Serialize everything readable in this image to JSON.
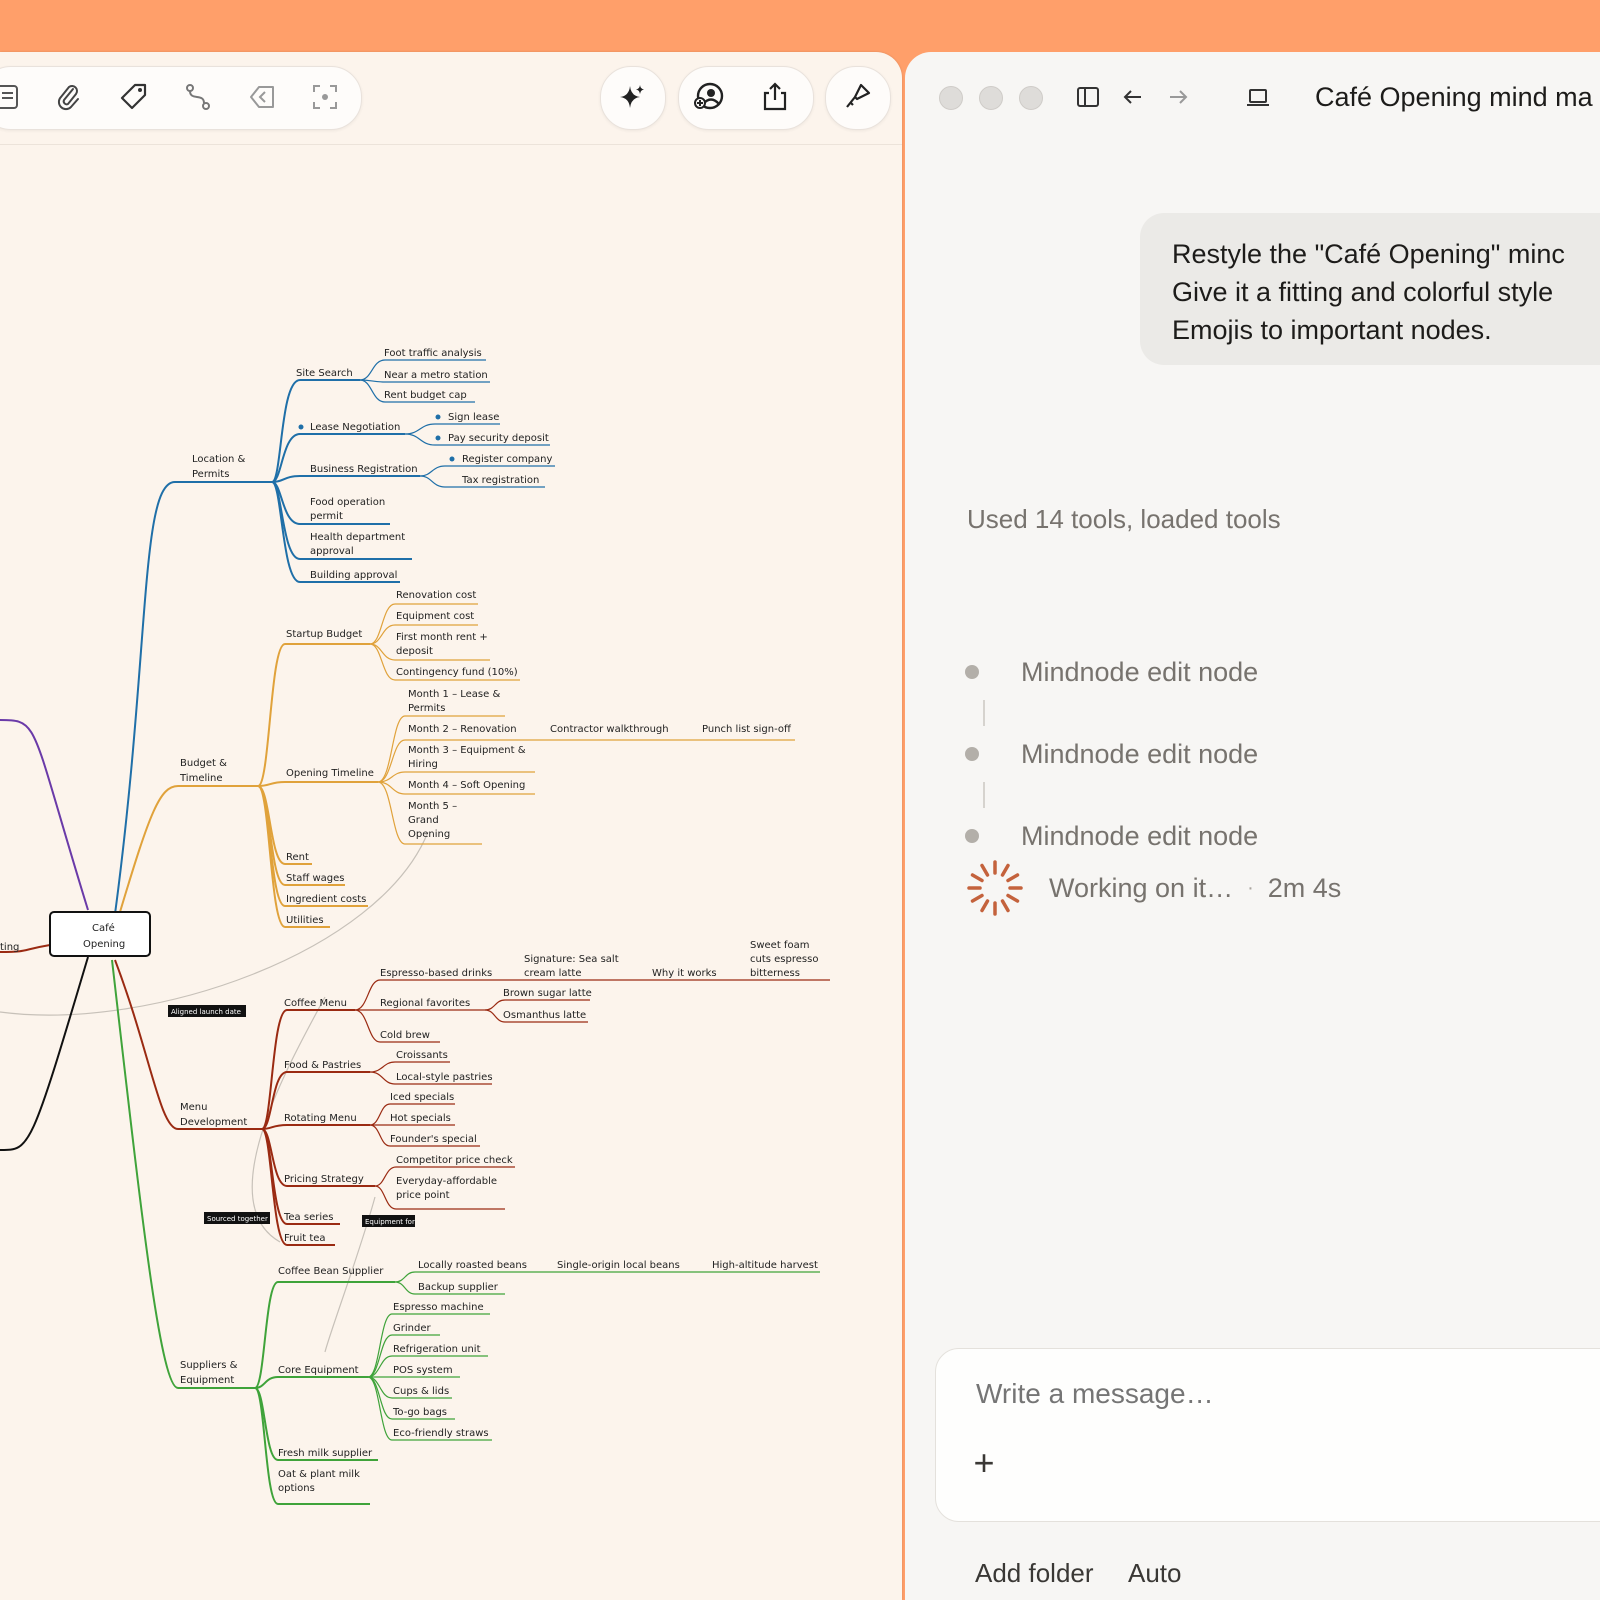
{
  "toolbar": {
    "left_icons": [
      "note-icon",
      "paperclip-icon",
      "tag-icon",
      "connection-icon",
      "back-arrow-icon",
      "focus-icon"
    ],
    "right_icons": [
      "sparkle-icon",
      "collaborate-icon",
      "share-icon",
      "style-brush-icon"
    ]
  },
  "mindmap": {
    "root": "Café Opening",
    "root_line2": "Opening",
    "root_line1": "Café",
    "left_stub": "ting",
    "highlight_labels": [
      "Aligned launch date",
      "Sourced together",
      "Equipment for"
    ],
    "branches": [
      {
        "name": "Location & Permits",
        "color": "#1f6fa8",
        "children": [
          "Site Search",
          "Lease Negotiation",
          "Business Registration",
          "Food operation permit",
          "Health department approval",
          "Building approval"
        ],
        "leaves": [
          "Foot traffic analysis",
          "Near a metro station",
          "Rent budget cap",
          "Sign lease",
          "Pay security deposit",
          "Register company",
          "Tax registration"
        ]
      },
      {
        "name": "Budget & Timeline",
        "color": "#e0a23b",
        "children": [
          "Startup Budget",
          "Opening Timeline",
          "Rent",
          "Staff wages",
          "Ingredient costs",
          "Utilities"
        ],
        "leaves": [
          "Renovation cost",
          "Equipment cost",
          "First month rent + deposit",
          "Contingency fund (10%)",
          "Month 1 – Lease & Permits",
          "Month 2 – Renovation",
          "Contractor walkthrough",
          "Punch list sign-off",
          "Month 3 – Equipment & Hiring",
          "Month 4 – Soft Opening",
          "Month 5 – Grand Opening"
        ]
      },
      {
        "name": "Menu Development",
        "color": "#9a2a12",
        "children": [
          "Coffee Menu",
          "Food & Pastries",
          "Rotating Menu",
          "Pricing Strategy",
          "Tea series",
          "Fruit tea"
        ],
        "leaves": [
          "Espresso-based drinks",
          "Signature: Sea salt cream latte",
          "Why it works",
          "Sweet foam cuts espresso bitterness",
          "Regional favorites",
          "Brown sugar latte",
          "Osmanthus latte",
          "Cold brew",
          "Croissants",
          "Local-style pastries",
          "Iced specials",
          "Hot specials",
          "Founder's special",
          "Competitor price check",
          "Everyday-affordable price point"
        ]
      },
      {
        "name": "Suppliers & Equipment",
        "color": "#3fa33a",
        "children": [
          "Coffee Bean Supplier",
          "Core Equipment",
          "Fresh milk supplier",
          "Oat & plant milk options"
        ],
        "leaves": [
          "Locally roasted beans",
          "Single-origin local beans",
          "High-altitude harvest",
          "Backup supplier",
          "Espresso machine",
          "Grinder",
          "Refrigeration unit",
          "POS system",
          "Cups & lids",
          "To-go bags",
          "Eco-friendly straws"
        ]
      }
    ]
  },
  "chat": {
    "window_title": "Café Opening mind ma",
    "user_message_lines": [
      "Restyle the \"Café Opening\" minc",
      "Give it a fitting and colorful style",
      "Emojis to important nodes."
    ],
    "used_tools": "Used 14 tools, loaded tools",
    "tool_items": [
      "Mindnode edit node",
      "Mindnode edit node",
      "Mindnode edit node"
    ],
    "working_label": "Working on it…",
    "working_sep": "·",
    "working_time": "2m 4s",
    "composer_placeholder": "Write a message…",
    "plus": "+",
    "add_folder": "Add folder",
    "mode": "Auto"
  }
}
